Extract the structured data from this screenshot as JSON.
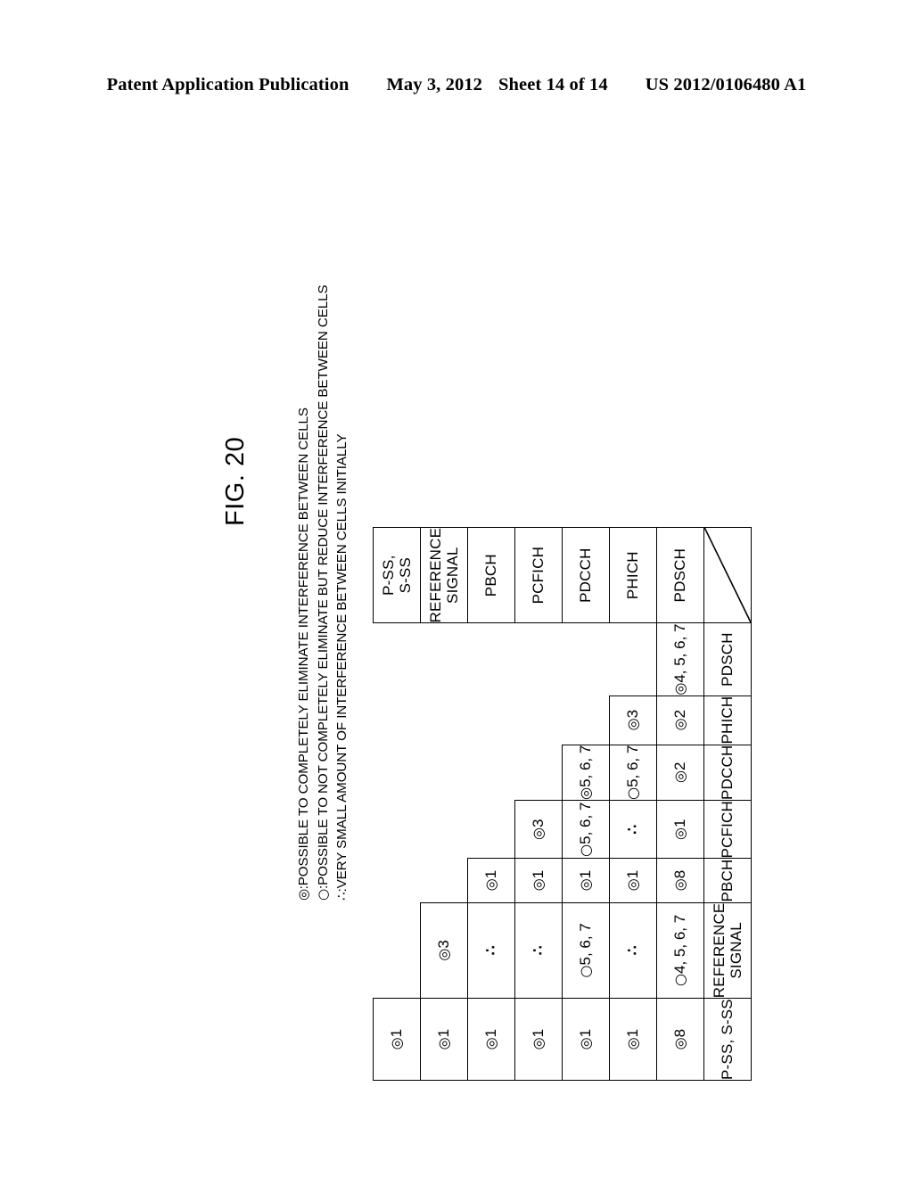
{
  "header": {
    "publication": "Patent Application Publication",
    "date": "May 3, 2012",
    "sheet": "Sheet 14 of 14",
    "patent_number": "US 2012/0106480 A1"
  },
  "figure": {
    "title": "FIG. 20",
    "legend": [
      {
        "symbol": "◎",
        "separator": ":",
        "text": "POSSIBLE TO COMPLETELY ELIMINATE INTERFERENCE BETWEEN CELLS"
      },
      {
        "symbol": "○",
        "separator": ":",
        "text": "POSSIBLE TO NOT COMPLETELY ELIMINATE BUT REDUCE INTERFERENCE BETWEEN CELLS"
      },
      {
        "symbol": "∴",
        "separator": ":",
        "text": "VERY SMALL AMOUNT OF INTERFERENCE BETWEEN CELLS INITIALLY"
      }
    ]
  },
  "table": {
    "row_labels": [
      "P-SS, S-SS",
      "REFERENCE SIGNAL",
      "PBCH",
      "PCFICH",
      "PDCCH",
      "PHICH",
      "PDSCH"
    ],
    "column_labels": [
      "P-SS, S-SS",
      "REFERENCE SIGNAL",
      "PBCH",
      "PCFICH",
      "PDCCH",
      "PHICH",
      "PDSCH"
    ],
    "corner_label": "",
    "rows": [
      {
        "label": "P-SS, S-SS",
        "cells": [
          "◎1",
          "",
          "",
          "",
          "",
          "",
          ""
        ]
      },
      {
        "label": "REFERENCE SIGNAL",
        "cells": [
          "◎1",
          "◎3",
          "",
          "",
          "",
          "",
          ""
        ]
      },
      {
        "label": "PBCH",
        "cells": [
          "◎1",
          "∴",
          "◎1",
          "",
          "",
          "",
          ""
        ]
      },
      {
        "label": "PCFICH",
        "cells": [
          "◎1",
          "∴",
          "◎1",
          "◎3",
          "",
          "",
          ""
        ]
      },
      {
        "label": "PDCCH",
        "cells": [
          "◎1",
          "○5, 6, 7",
          "◎1",
          "○5, 6, 7",
          "◎5, 6, 7",
          "",
          ""
        ]
      },
      {
        "label": "PHICH",
        "cells": [
          "◎1",
          "∴",
          "◎1",
          "∴",
          "○5, 6, 7",
          "◎3",
          ""
        ]
      },
      {
        "label": "PDSCH",
        "cells": [
          "◎8",
          "○4, 5, 6, 7",
          "◎8",
          "◎1",
          "◎2",
          "◎2",
          "◎4, 5, 6, 7"
        ]
      }
    ]
  }
}
